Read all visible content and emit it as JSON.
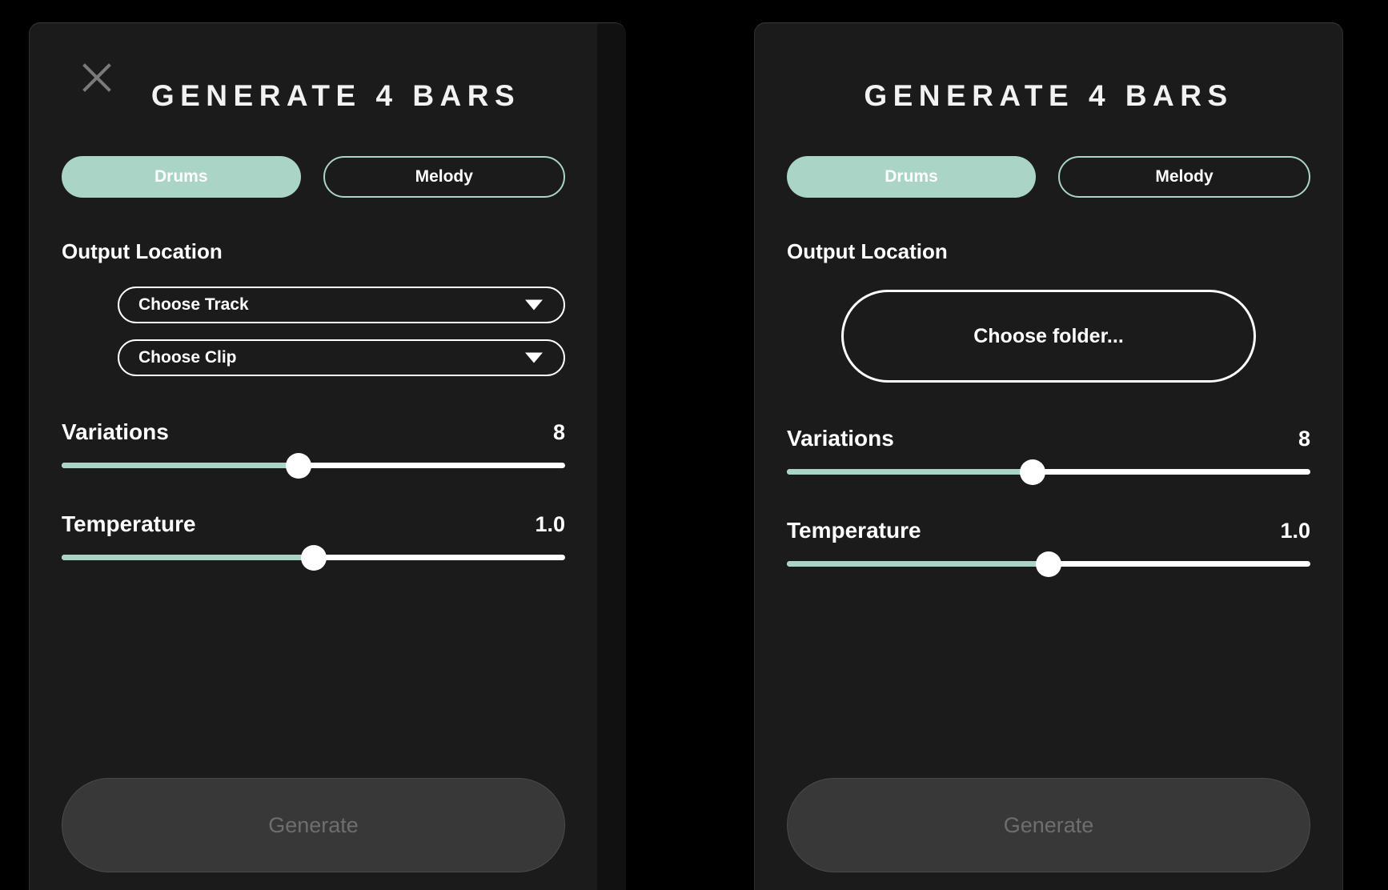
{
  "accent_color": "#a9d4c6",
  "panel_bg": "#1b1b1b",
  "page_bg": "#000000",
  "disabled_color": "#6e6e6e",
  "left_panel": {
    "title": "GENERATE 4 BARS",
    "close_icon": "close-icon",
    "modes": [
      {
        "label": "Drums",
        "selected": true
      },
      {
        "label": "Melody",
        "selected": false
      }
    ],
    "output_location_label": "Output Location",
    "dropdowns": [
      {
        "label": "Choose Track",
        "caret": "chevron-down-icon"
      },
      {
        "label": "Choose Clip",
        "caret": "chevron-down-icon"
      }
    ],
    "sliders": [
      {
        "name": "Variations",
        "value": "8",
        "percent": 47
      },
      {
        "name": "Temperature",
        "value": "1.0",
        "percent": 50
      }
    ],
    "generate_label": "Generate",
    "generate_enabled": false
  },
  "right_panel": {
    "title": "GENERATE 4 BARS",
    "modes": [
      {
        "label": "Drums",
        "selected": true
      },
      {
        "label": "Melody",
        "selected": false
      }
    ],
    "output_location_label": "Output Location",
    "folder_button_label": "Choose folder...",
    "sliders": [
      {
        "name": "Variations",
        "value": "8",
        "percent": 47
      },
      {
        "name": "Temperature",
        "value": "1.0",
        "percent": 50
      }
    ],
    "generate_label": "Generate",
    "generate_enabled": false
  }
}
